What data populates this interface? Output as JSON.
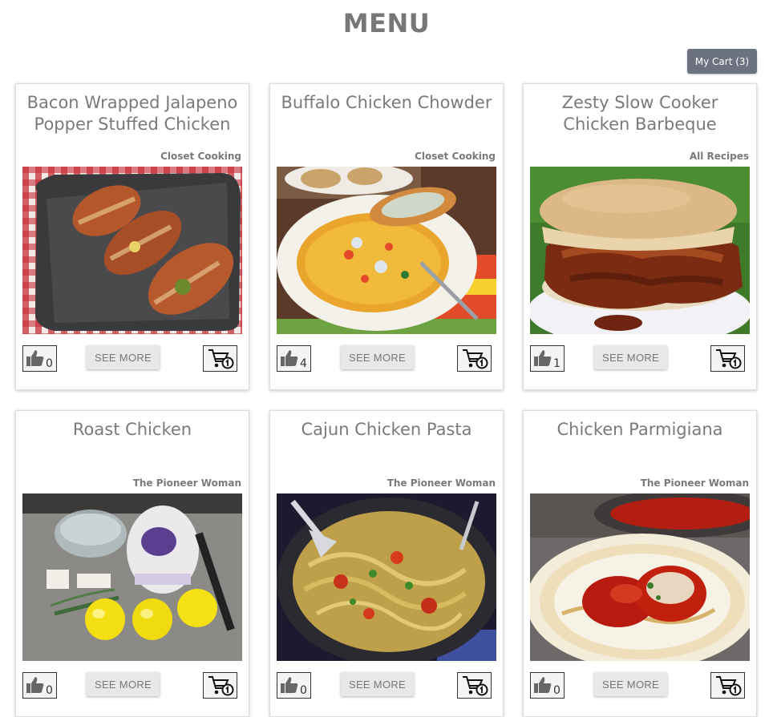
{
  "header": {
    "title": "MENU",
    "cart_label": "My Cart (3)"
  },
  "colors": {
    "cart_button_bg": "#6c727f",
    "text_gray": "#777777",
    "button_gray": "#e8e8e8"
  },
  "cards": [
    {
      "title": "Bacon Wrapped Jalapeno Popper Stuffed Chicken",
      "source": "Closet Cooking",
      "likes": "0",
      "see_more": "SEE MORE",
      "image": "bacon-wrapped-chicken-photo"
    },
    {
      "title": "Buffalo Chicken Chowder",
      "source": "Closet Cooking",
      "likes": "4",
      "see_more": "SEE MORE",
      "image": "chowder-bowl-photo"
    },
    {
      "title": "Zesty Slow Cooker Chicken Barbeque",
      "source": "All Recipes",
      "likes": "1",
      "see_more": "SEE MORE",
      "image": "bbq-sandwich-photo"
    },
    {
      "title": "Roast Chicken",
      "source": "The Pioneer Woman",
      "likes": "0",
      "see_more": "SEE MORE",
      "image": "raw-chicken-lemons-photo"
    },
    {
      "title": "Cajun Chicken Pasta",
      "source": "The Pioneer Woman",
      "likes": "0",
      "see_more": "SEE MORE",
      "image": "pasta-skillet-photo"
    },
    {
      "title": "Chicken Parmigiana",
      "source": "The Pioneer Woman",
      "likes": "0",
      "see_more": "SEE MORE",
      "image": "parmigiana-plate-photo"
    }
  ],
  "icons": {
    "like": "thumbs-up-icon",
    "add_to_cart": "cart-add-icon"
  }
}
